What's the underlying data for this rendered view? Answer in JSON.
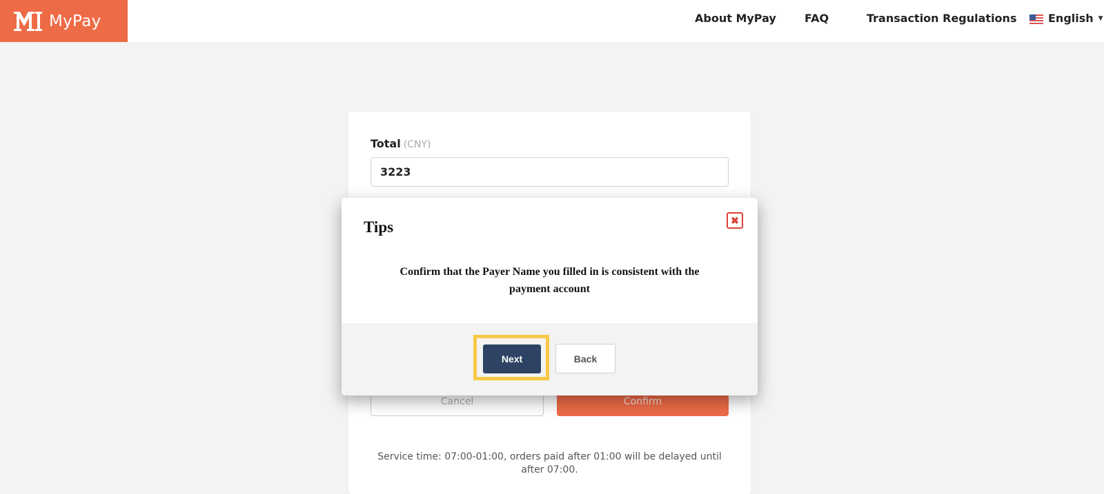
{
  "brand": {
    "name": "MyPay",
    "color": "#ee6b47"
  },
  "nav": {
    "items": [
      {
        "label": "About MyPay"
      },
      {
        "label": "FAQ"
      },
      {
        "label": "Transaction Regulations"
      }
    ],
    "language": {
      "label": "English",
      "flag_icon": "us-flag-icon"
    }
  },
  "form": {
    "total_label": "Total",
    "total_unit": "(CNY)",
    "total_value": "3223",
    "cancel_label": "Cancel",
    "confirm_label": "Confirm",
    "service_time": "Service time: 07:00-01:00, orders paid after 01:00 will be delayed until after 07:00."
  },
  "modal": {
    "title": "Tips",
    "message": "Confirm that the Payer Name you filled in is consistent with the payment account",
    "next_label": "Next",
    "back_label": "Back",
    "close_icon": "close-icon",
    "highlight_color": "#f7c948",
    "next_color": "#2e4364"
  }
}
